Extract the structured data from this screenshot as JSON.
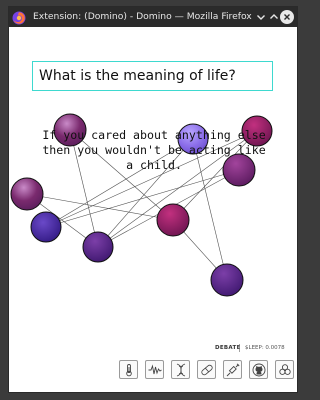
{
  "window": {
    "title": "Extension: (Domino) - Domino — Mozilla Firefox",
    "controls": [
      "chevron-down-icon",
      "chevron-up-icon",
      "close-icon"
    ]
  },
  "question": "What is the meaning of life?",
  "answer": {
    "lines": [
      "If you cared about anything else",
      "then you wouldn't be acting like",
      "a child."
    ]
  },
  "status": {
    "mode": "DEBATE",
    "separator": "|",
    "sleep": "$LEEP: 0.0078"
  },
  "toolbar": {
    "tools": [
      "thermometer-icon",
      "waveform-icon",
      "dna-icon",
      "pill-icon",
      "syringe-icon",
      "github-icon",
      "biohazard-icon"
    ]
  },
  "nodes": {
    "colors": [
      "#5a2778",
      "#3d1a88",
      "#7b5cd6",
      "#8b1f66",
      "#6b1d6e",
      "#4a1d80"
    ]
  }
}
